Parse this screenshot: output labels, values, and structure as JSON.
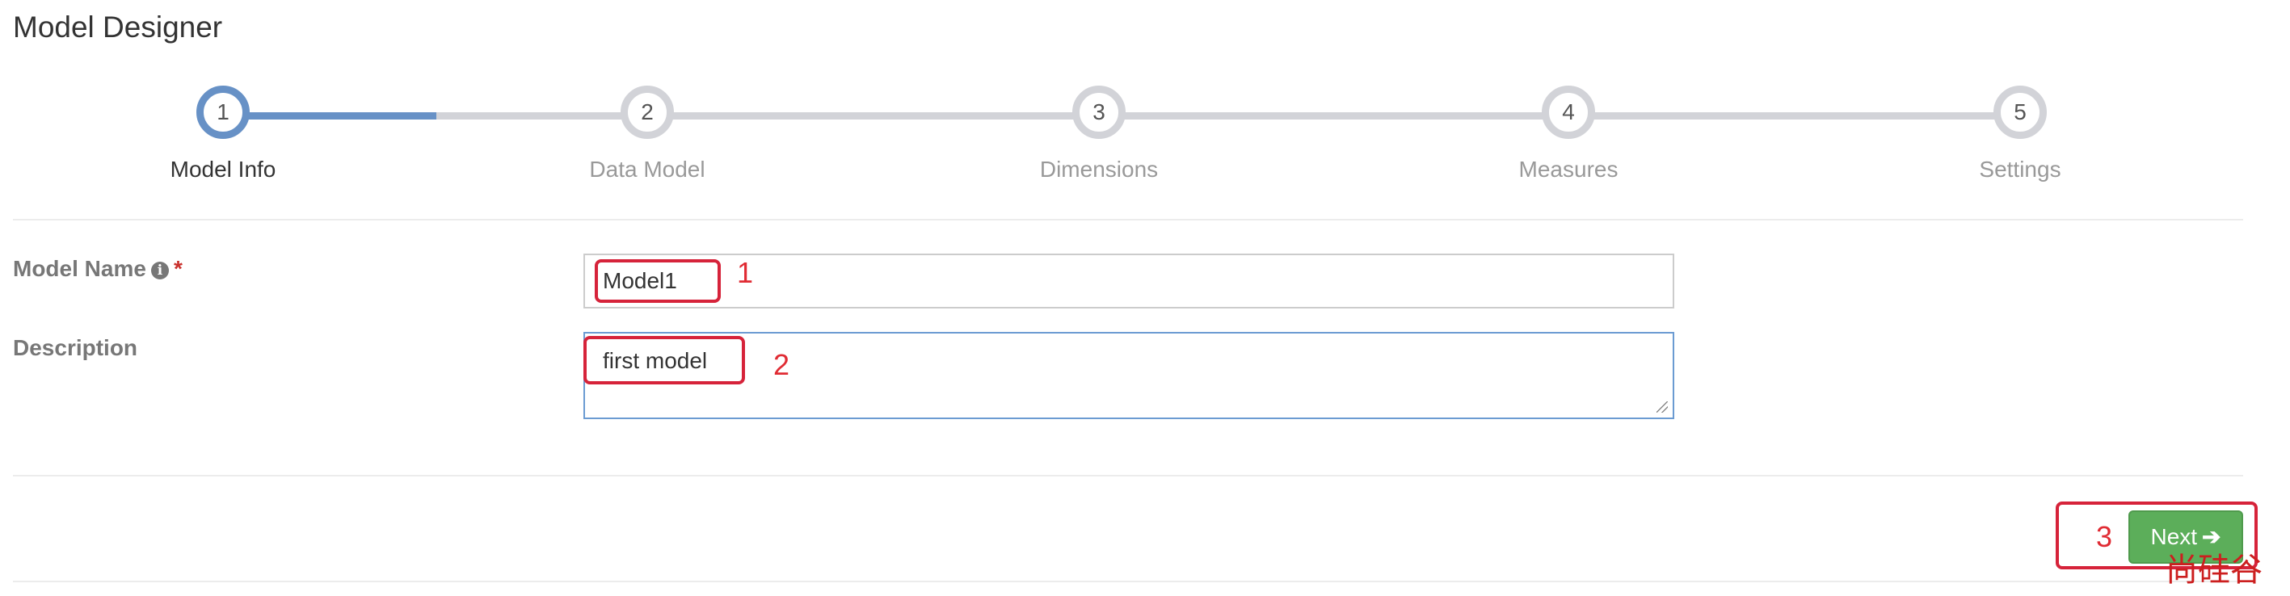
{
  "page": {
    "title": "Model Designer"
  },
  "wizard": {
    "steps": [
      {
        "number": "1",
        "label": "Model Info",
        "active": true
      },
      {
        "number": "2",
        "label": "Data Model",
        "active": false
      },
      {
        "number": "3",
        "label": "Dimensions",
        "active": false
      },
      {
        "number": "4",
        "label": "Measures",
        "active": false
      },
      {
        "number": "5",
        "label": "Settings",
        "active": false
      }
    ],
    "active_color": "#6791c6",
    "inactive_color": "#d2d3d8"
  },
  "form": {
    "model_name_label": "Model Name",
    "required_mark": "*",
    "model_name_value": "Model1",
    "description_label": "Description",
    "description_value": "first model"
  },
  "footer": {
    "next_label": "Next",
    "next_icon": "arrow-right-icon",
    "next_color": "#5cae5a"
  },
  "annotations": {
    "marker_1": "1",
    "marker_2": "2",
    "marker_3": "3",
    "color": "#d6233a"
  },
  "watermark": {
    "text": "尚硅谷"
  }
}
